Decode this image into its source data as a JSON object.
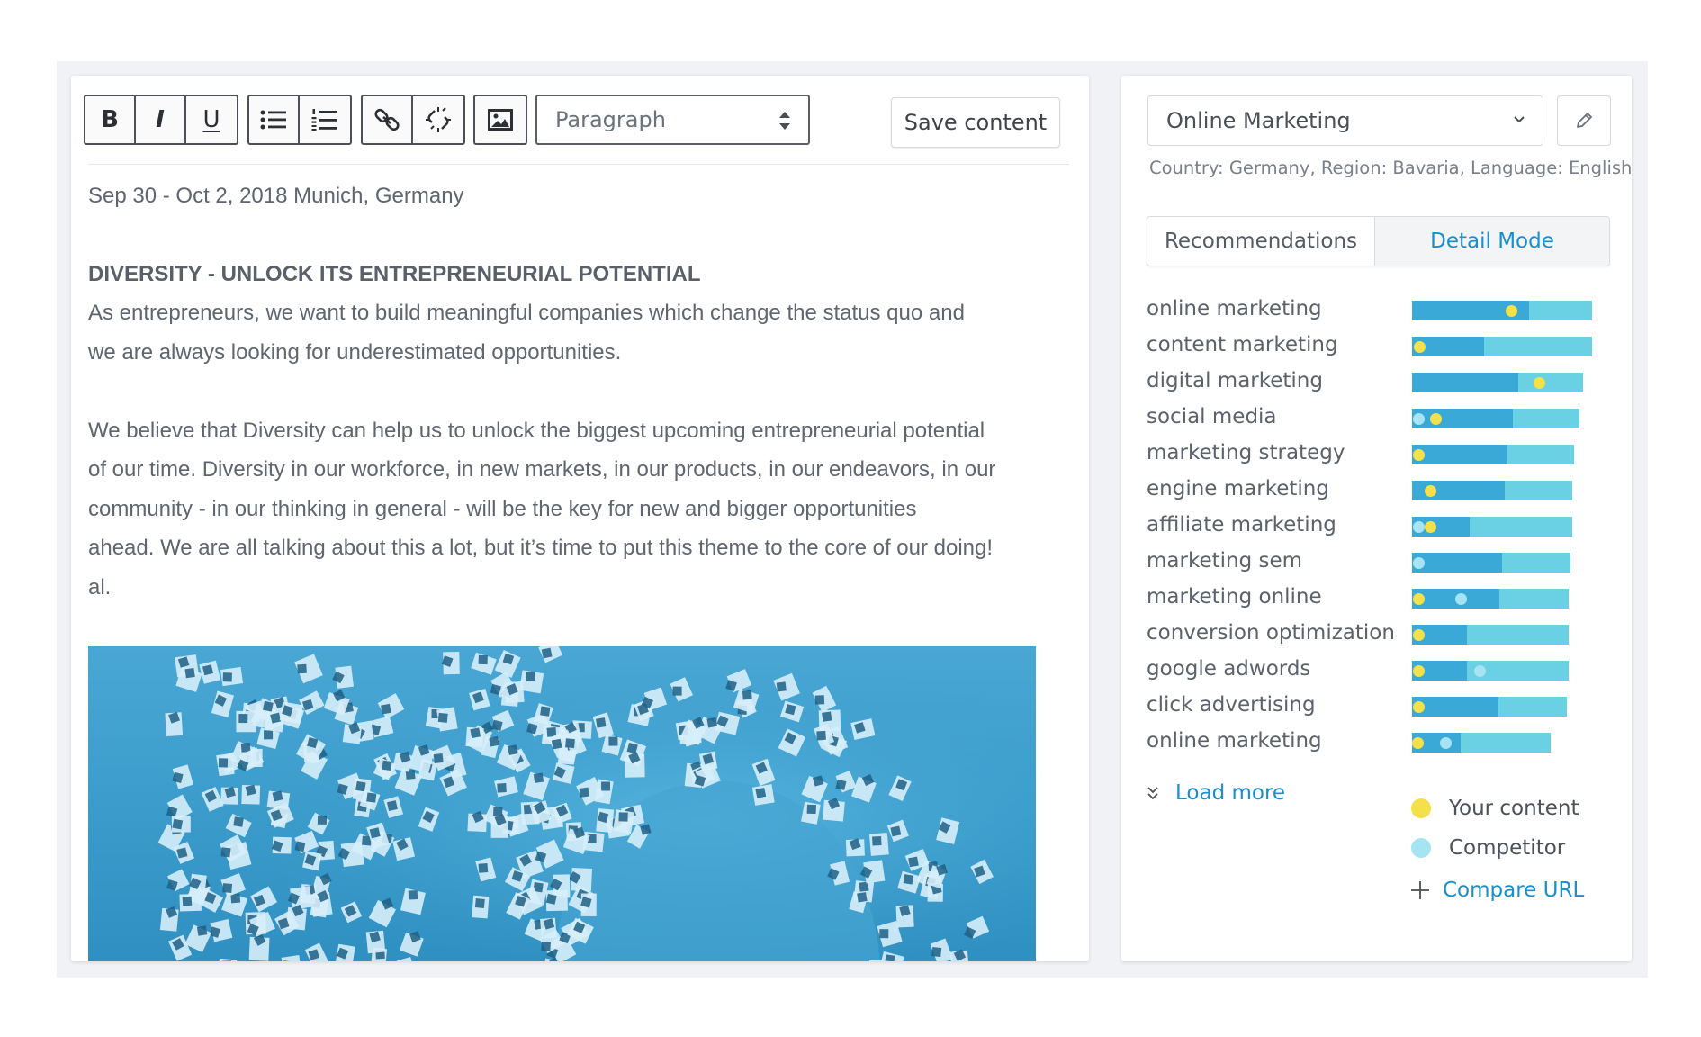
{
  "toolbar": {
    "buttons": [
      {
        "name": "bold-icon",
        "glyph": "B"
      },
      {
        "name": "italic-icon",
        "glyph": "I"
      },
      {
        "name": "underline-icon",
        "glyph": "U"
      },
      {
        "name": "bullet-list-icon"
      },
      {
        "name": "numbered-list-icon"
      },
      {
        "name": "link-icon"
      },
      {
        "name": "unlink-icon"
      },
      {
        "name": "image-icon"
      }
    ],
    "format_select": "Paragraph",
    "save_label": "Save content"
  },
  "editor": {
    "date_line": "Sep 30 - Oct 2, 2018 Munich, Germany",
    "heading": "DIVERSITY - UNLOCK ITS ENTREPRENEURIAL POTENTIAL",
    "paragraph1_line1": "As entrepreneurs, we want to build meaningful companies which change the status quo and",
    "paragraph1_line2": "we are always looking for underestimated opportunities.",
    "paragraph2_line1": "We believe that Diversity can help us to unlock the biggest upcoming entrepreneurial potential",
    "paragraph2_line2": "of our time. Diversity in our workforce, in new markets, in our products, in our endeavors, in our",
    "paragraph2_line3": "community - in our thinking in general - will be the key for new and bigger opportunities",
    "paragraph2_line4": "ahead. We are all talking about this a lot, but it’s time to put this theme to the core of our doing!",
    "paragraph3": "al."
  },
  "sidebar": {
    "topic": "Online Marketing",
    "meta": "Country: Germany, Region: Bavaria, Language: English",
    "tabs": [
      {
        "label": "Recommendations",
        "active": false
      },
      {
        "label": "Detail Mode",
        "active": true
      }
    ],
    "keywords": [
      {
        "label": "online marketing",
        "bar": 1.0,
        "fill": 0.65,
        "you": 0.55,
        "competitor": null
      },
      {
        "label": "content marketing",
        "bar": 1.0,
        "fill": 0.4,
        "you": 0.04,
        "competitor": null
      },
      {
        "label": "digital marketing",
        "bar": 0.95,
        "fill": 0.62,
        "you": 0.74,
        "competitor": null
      },
      {
        "label": "social media",
        "bar": 0.93,
        "fill": 0.6,
        "you": 0.14,
        "competitor": 0.04
      },
      {
        "label": "marketing strategy",
        "bar": 0.9,
        "fill": 0.59,
        "you": 0.04,
        "competitor": null
      },
      {
        "label": "engine marketing",
        "bar": 0.89,
        "fill": 0.58,
        "you": 0.11,
        "competitor": null
      },
      {
        "label": "affiliate marketing",
        "bar": 0.89,
        "fill": 0.36,
        "you": 0.11,
        "competitor": 0.04
      },
      {
        "label": "marketing sem",
        "bar": 0.88,
        "fill": 0.57,
        "you": null,
        "competitor": 0.04
      },
      {
        "label": "marketing online",
        "bar": 0.87,
        "fill": 0.56,
        "you": 0.04,
        "competitor": 0.31
      },
      {
        "label": "conversion optimization",
        "bar": 0.87,
        "fill": 0.35,
        "you": 0.04,
        "competitor": null
      },
      {
        "label": "google adwords",
        "bar": 0.87,
        "fill": 0.35,
        "you": 0.04,
        "competitor": 0.43
      },
      {
        "label": "click advertising",
        "bar": 0.86,
        "fill": 0.56,
        "you": 0.04,
        "competitor": null
      },
      {
        "label": "online marketing",
        "bar": 0.77,
        "fill": 0.35,
        "you": 0.04,
        "competitor": 0.24
      }
    ],
    "load_more": "Load more",
    "legend": {
      "you_label": "Your content",
      "competitor_label": "Competitor"
    },
    "compare_label": "Compare URL"
  },
  "colors": {
    "accent": "#1a8fd0",
    "bar_bg": "#6ad0e3",
    "bar_fill": "#3aa9d8",
    "you": "#f4e14a",
    "competitor": "#a6e4f3"
  }
}
